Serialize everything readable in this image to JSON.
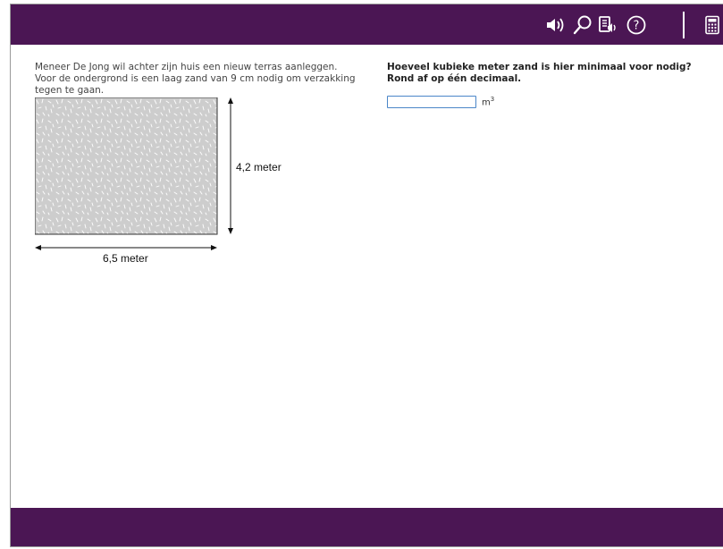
{
  "toolbar": {
    "items": [
      {
        "name": "speaker-icon",
        "label": "Voorlezen"
      },
      {
        "name": "magnifier-icon",
        "label": "Vergroten"
      },
      {
        "name": "read-aloud-icon",
        "label": "Tekst voorlezen"
      },
      {
        "name": "help-icon",
        "label": "Help"
      },
      {
        "name": "calculator-icon",
        "label": "Rekenmachine"
      }
    ]
  },
  "problem": {
    "text": "Meneer De Jong wil achter zijn huis een nieuw terras aanleggen. Voor de ondergrond is een laag zand van 9 cm nodig om verzakking tegen te gaan."
  },
  "question": {
    "line1": "Hoeveel kubieke meter zand is hier minimaal voor nodig?",
    "line2": "Rond af op één decimaal."
  },
  "answer": {
    "value": "",
    "placeholder": "",
    "unit_base": "m",
    "unit_exp": "3"
  },
  "figure": {
    "height_label": "4,2 meter",
    "width_label": "6,5 meter"
  },
  "colors": {
    "brand": "#4b1654",
    "sand": "#cfcfcf",
    "input_border": "#4b86c8"
  }
}
